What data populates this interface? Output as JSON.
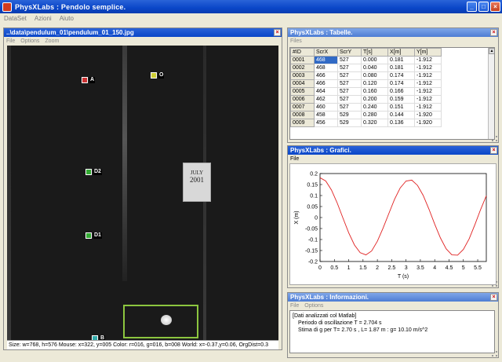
{
  "window": {
    "title": "PhysXLabs :  Pendolo semplice."
  },
  "menu": [
    "DataSet",
    "Azioni",
    "Aiuto"
  ],
  "image_panel": {
    "title": "..\\data\\pendulum_01\\pendulum_01_150.jpg",
    "menu": [
      "File",
      "Options",
      "Zoom"
    ],
    "markers": [
      "A",
      "O",
      "D2",
      "D1",
      "B"
    ],
    "sign_text": [
      "JULY",
      "2001"
    ],
    "status": "Size: w=768, h=576 Mouse: x=322, y=005 Color: r=016, g=016, b=008  World: x=-0.37,y=0.06, OrgDist=0.3"
  },
  "table_panel": {
    "title": "PhysXLabs :  Tabelle.",
    "menu": [
      "Files"
    ],
    "columns": [
      "#ID",
      "ScrX",
      "ScrY",
      "T[s]",
      "X[m]",
      "Y[m]"
    ],
    "rows": [
      [
        "0001",
        "468",
        "527",
        "0.000",
        "0.181",
        "-1.912"
      ],
      [
        "0002",
        "468",
        "527",
        "0.040",
        "0.181",
        "-1.912"
      ],
      [
        "0003",
        "466",
        "527",
        "0.080",
        "0.174",
        "-1.912"
      ],
      [
        "0004",
        "466",
        "527",
        "0.120",
        "0.174",
        "-1.912"
      ],
      [
        "0005",
        "464",
        "527",
        "0.160",
        "0.166",
        "-1.912"
      ],
      [
        "0006",
        "462",
        "527",
        "0.200",
        "0.159",
        "-1.912"
      ],
      [
        "0007",
        "460",
        "527",
        "0.240",
        "0.151",
        "-1.912"
      ],
      [
        "0008",
        "458",
        "529",
        "0.280",
        "0.144",
        "-1.920"
      ],
      [
        "0009",
        "456",
        "529",
        "0.320",
        "0.136",
        "-1.920"
      ]
    ]
  },
  "chart_panel": {
    "title": "PhysXLabs :  Grafici.",
    "menu": [
      "File"
    ]
  },
  "chart_data": {
    "type": "line",
    "xlabel": "T (s)",
    "ylabel": "X (m)",
    "xlim": [
      0,
      5.8
    ],
    "ylim": [
      -0.2,
      0.2
    ],
    "xticks": [
      "0",
      "0.5",
      "1",
      "1.5",
      "2",
      "2.5",
      "3",
      "3.5",
      "4",
      "4.5",
      "5",
      "5.5"
    ],
    "yticks": [
      "0.2",
      "0.15",
      "0.1",
      "0.05",
      "0",
      "-0.05",
      "-0.1",
      "-0.15",
      "-0.2"
    ],
    "color": "#e02020",
    "series": [
      {
        "x": [
          0,
          0.2,
          0.4,
          0.6,
          0.8,
          1.0,
          1.2,
          1.4,
          1.6,
          1.8,
          2.0,
          2.2,
          2.4,
          2.6,
          2.8,
          3.0,
          3.2,
          3.4,
          3.6,
          3.8,
          4.0,
          4.2,
          4.4,
          4.6,
          4.8,
          5.0,
          5.2,
          5.4,
          5.6,
          5.8
        ],
        "values": [
          0.181,
          0.166,
          0.125,
          0.066,
          -0.002,
          -0.07,
          -0.125,
          -0.16,
          -0.17,
          -0.152,
          -0.108,
          -0.048,
          0.018,
          0.083,
          0.135,
          0.166,
          0.17,
          0.146,
          0.1,
          0.038,
          -0.03,
          -0.093,
          -0.142,
          -0.17,
          -0.171,
          -0.145,
          -0.097,
          -0.033,
          0.036,
          0.099
        ]
      }
    ]
  },
  "info_panel": {
    "title": "PhysXLabs :  Informazioni.",
    "menu": [
      "File",
      "Options"
    ],
    "lines": [
      "[Dati analizzati col Matlab]",
      "Periodo di oscillazione T = 2.704 s",
      "Stima di g per T= 2.70 s , L= 1.87 m :   g= 10.10 m/s^2"
    ]
  }
}
